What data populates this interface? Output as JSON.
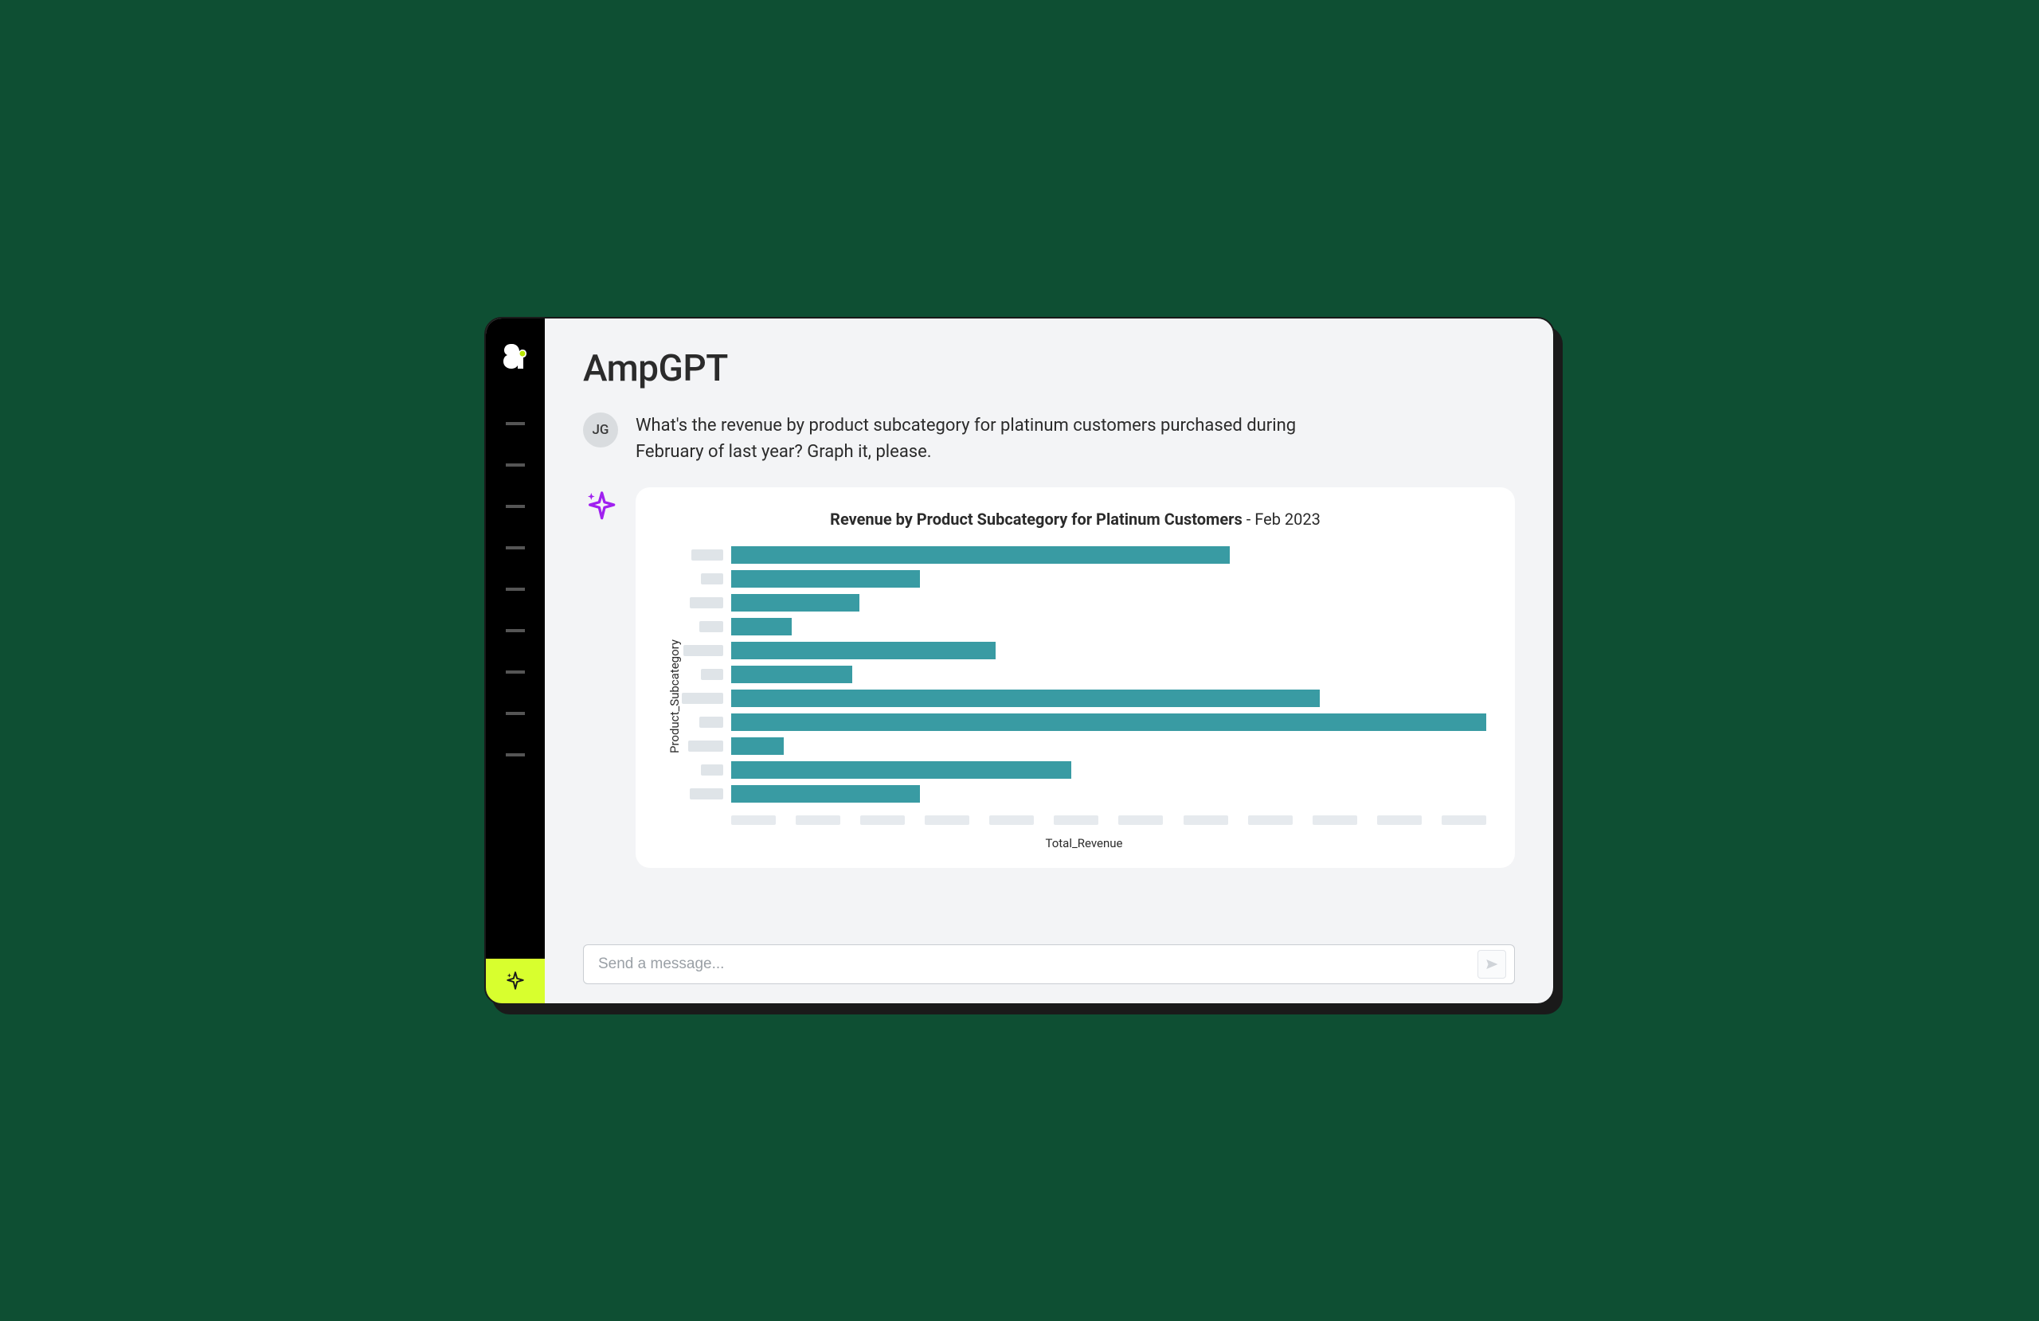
{
  "app": {
    "title": "AmpGPT"
  },
  "sidebar": {
    "nav_item_count": 9
  },
  "conversation": {
    "user": {
      "initials": "JG",
      "message": "What's the revenue by product subcategory for platinum customers purchased during February of last year? Graph it, please."
    }
  },
  "chat_input": {
    "placeholder": "Send a message..."
  },
  "colors": {
    "bar": "#399ba3",
    "accent": "#d8ff2e",
    "sparkle": "#a020f0"
  },
  "chart_data": {
    "type": "bar",
    "orientation": "horizontal",
    "title_bold": "Revenue by Product Subcategory for Platinum Customers",
    "title_separator": " - ",
    "title_suffix": "Feb 2023",
    "xlabel": "Total_Revenue",
    "ylabel": "Product_Subcategory",
    "xlim": [
      0,
      100
    ],
    "categories_rendered_as_placeholders": true,
    "category_chip_widths": [
      40,
      28,
      42,
      30,
      50,
      28,
      52,
      30,
      44,
      28,
      42
    ],
    "values": [
      66,
      25,
      17,
      8,
      35,
      16,
      78,
      100,
      7,
      45,
      25
    ],
    "xtick_count": 12
  }
}
